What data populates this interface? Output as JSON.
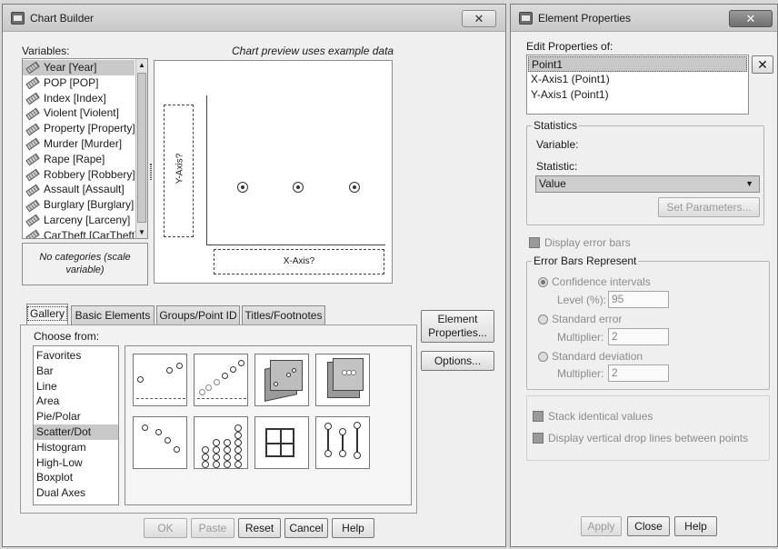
{
  "chart_builder": {
    "title": "Chart Builder",
    "close_glyph": "✕",
    "variables_label": "Variables:",
    "preview_note": "Chart preview uses example data",
    "variables": [
      "Year [Year]",
      "POP [POP]",
      "Index [Index]",
      "Violent [Violent]",
      "Property [Property]",
      "Murder [Murder]",
      "Rape [Rape]",
      "Robbery [Robbery]",
      "Assault [Assault]",
      "Burglary [Burglary]",
      "Larceny [Larceny]",
      "CarTheft [CarTheft]"
    ],
    "no_categories": "No categories (scale variable)",
    "y_axis_drop": "Y-Axis?",
    "x_axis_drop": "X-Axis?",
    "tabs": [
      "Gallery",
      "Basic Elements",
      "Groups/Point ID",
      "Titles/Footnotes"
    ],
    "choose_from_label": "Choose from:",
    "chart_types": [
      "Favorites",
      "Bar",
      "Line",
      "Area",
      "Pie/Polar",
      "Scatter/Dot",
      "Histogram",
      "High-Low",
      "Boxplot",
      "Dual Axes"
    ],
    "selected_chart_type": "Scatter/Dot",
    "side_buttons": {
      "element_properties": "Element Properties...",
      "options": "Options..."
    },
    "bottom_buttons": {
      "ok": "OK",
      "paste": "Paste",
      "reset": "Reset",
      "cancel": "Cancel",
      "help": "Help"
    }
  },
  "element_properties": {
    "title": "Element Properties",
    "close_glyph": "✕",
    "edit_label": "Edit Properties of:",
    "elements": [
      "Point1",
      "X-Axis1 (Point1)",
      "Y-Axis1 (Point1)"
    ],
    "delete_glyph": "✕",
    "statistics_group": "Statistics",
    "variable_label": "Variable:",
    "statistic_label": "Statistic:",
    "statistic_value": "Value",
    "set_parameters": "Set Parameters...",
    "display_error_bars": "Display error bars",
    "error_bars_group": "Error Bars Represent",
    "confidence_intervals": "Confidence intervals",
    "level_label": "Level (%):",
    "level_value": "95",
    "standard_error": "Standard error",
    "multiplier_label": "Multiplier:",
    "se_multiplier": "2",
    "standard_deviation": "Standard deviation",
    "sd_multiplier": "2",
    "stack_identical": "Stack identical values",
    "drop_lines": "Display vertical drop lines between points",
    "bottom_buttons": {
      "apply": "Apply",
      "close": "Close",
      "help": "Help"
    }
  }
}
